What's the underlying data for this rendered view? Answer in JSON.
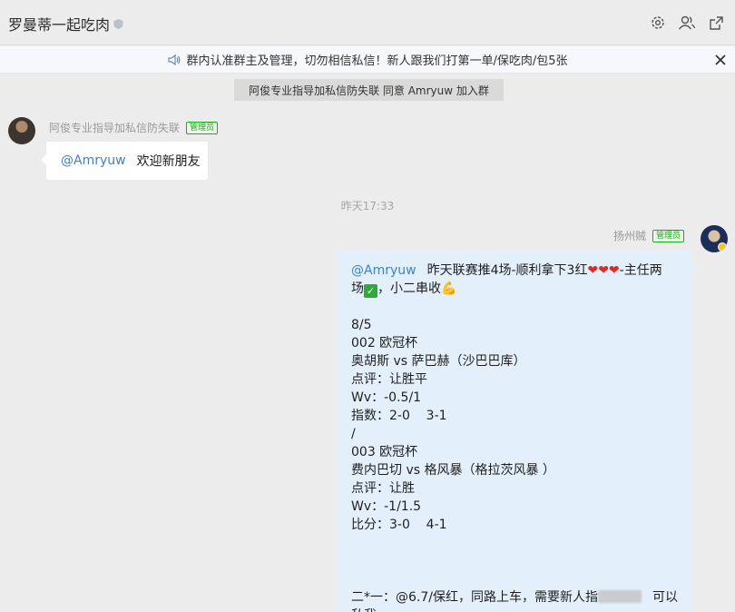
{
  "header": {
    "title": "罗曼蒂一起吃肉",
    "icons": [
      "gear-icon",
      "group-members-icon",
      "external-link-icon"
    ]
  },
  "notice": {
    "text": "群内认准群主及管理，切勿相信私信！新人跟我们打第一单/保吃肉/包5张",
    "icon": "speaker-icon",
    "close": "×"
  },
  "system_message": "阿俊专业指导加私信防失联 同意 Amryuw 加入群",
  "messages": [
    {
      "sender": "阿俊专业指导加私信防失联",
      "role_tag": "管理员",
      "mention": "@Amryuw",
      "text": "欢迎新朋友"
    }
  ],
  "timestamp": "昨天17:33",
  "right_message": {
    "sender": "扬州贼",
    "role_tag": "管理员",
    "mention": "@Amryuw",
    "intro_a": "昨天联赛推4场-顺利拿下3红",
    "intro_b": "-主任两",
    "intro_c": "场",
    "intro_d": "，小二串收",
    "lines": [
      "8/5",
      "002 欧冠杯",
      "奥胡斯 vs 萨巴赫（沙巴巴库）",
      "点评：让胜平",
      "Wv：-0.5/1",
      "指数：2-0    3-1",
      "/",
      "003 欧冠杯",
      "费内巴切 vs 格风暴（格拉茨风暴 ）",
      "点评：让胜",
      "Wv：-1/1.5",
      "比分：3-0    4-1"
    ],
    "tail_a": "二*一：@6.7/保红，同路上车，需要新人指",
    "tail_b": "可以",
    "tail_c": "私我"
  },
  "colors": {
    "background": "#ececec",
    "mention": "#3d82c4",
    "admin_tag": "#1aad19",
    "right_bubble": "#e3effb"
  }
}
